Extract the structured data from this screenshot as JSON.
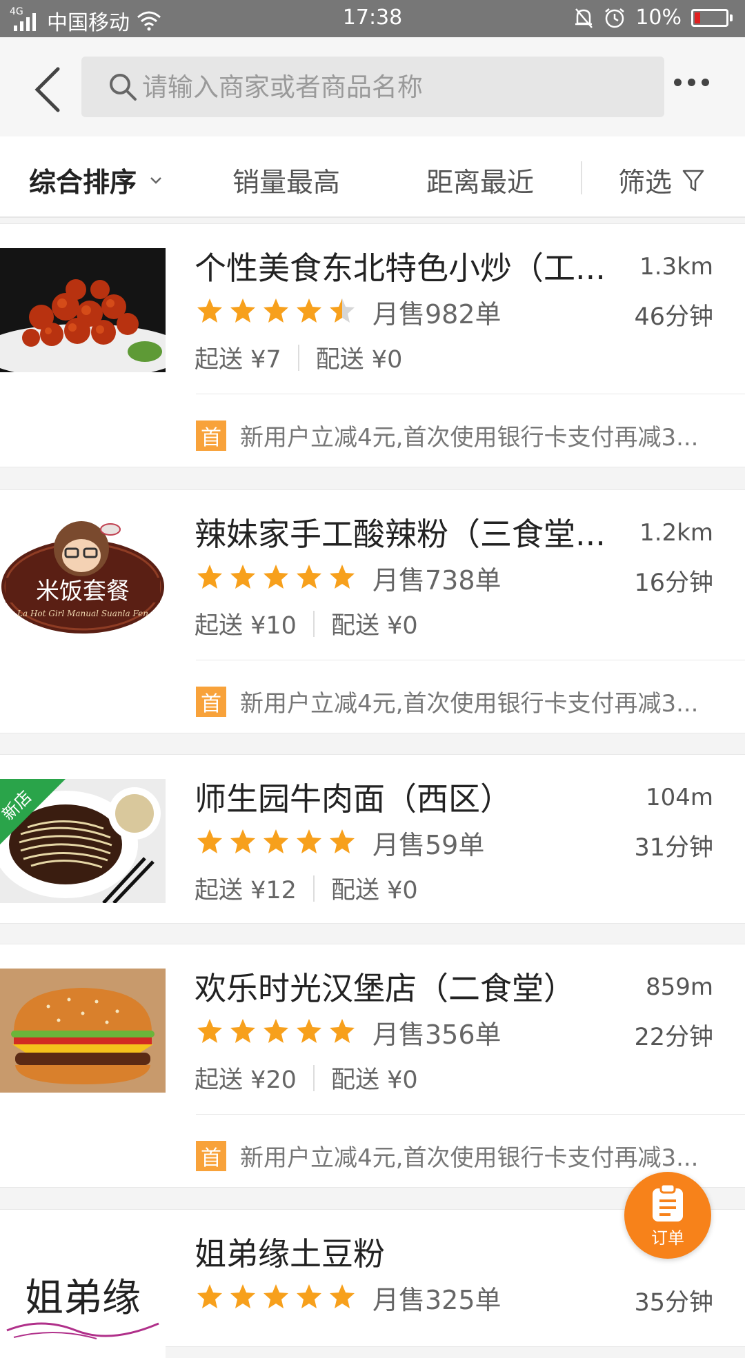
{
  "status_bar": {
    "network": "4G",
    "carrier": "中国移动",
    "time": "17:38",
    "battery": "10%",
    "icons": [
      "signal-icon",
      "wifi-icon",
      "bell-muted-icon",
      "alarm-icon",
      "battery-icon"
    ]
  },
  "search": {
    "placeholder": "请输入商家或者商品名称",
    "value": ""
  },
  "sort_tabs": [
    {
      "label": "综合排序",
      "active": true
    },
    {
      "label": "销量最高",
      "active": false
    },
    {
      "label": "距离最近",
      "active": false
    },
    {
      "label": "筛选",
      "active": false
    }
  ],
  "shops": [
    {
      "name": "个性美食东北特色小炒（工...",
      "distance": "1.3km",
      "rating": 4.5,
      "monthly_sales": "月售982单",
      "delivery_time": "46分钟",
      "min_order": "起送 ¥7",
      "delivery_fee": "配送 ¥0",
      "promo_badge": "首",
      "promo_text": "新用户立减4元,首次使用银行卡支付再减3...",
      "image": "fried-pork-dish",
      "new_store": false
    },
    {
      "name": "辣妹家手工酸辣粉（三食堂...",
      "distance": "1.2km",
      "rating": 5,
      "monthly_sales": "月售738单",
      "delivery_time": "16分钟",
      "min_order": "起送 ¥10",
      "delivery_fee": "配送 ¥0",
      "promo_badge": "首",
      "promo_text": "新用户立减4元,首次使用银行卡支付再减3...",
      "image": "spicy-girl-logo",
      "logo_text": "米饭套餐",
      "new_store": false
    },
    {
      "name": "师生园牛肉面（西区）",
      "distance": "104m",
      "rating": 5,
      "monthly_sales": "月售59单",
      "delivery_time": "31分钟",
      "min_order": "起送 ¥12",
      "delivery_fee": "配送 ¥0",
      "promo_badge": "",
      "promo_text": "",
      "image": "beef-noodle-bowl",
      "new_store": true,
      "new_store_label": "新店"
    },
    {
      "name": "欢乐时光汉堡店（二食堂）",
      "distance": "859m",
      "rating": 5,
      "monthly_sales": "月售356单",
      "delivery_time": "22分钟",
      "min_order": "起送 ¥20",
      "delivery_fee": "配送 ¥0",
      "promo_badge": "首",
      "promo_text": "新用户立减4元,首次使用银行卡支付再减3...",
      "image": "burger",
      "new_store": false
    },
    {
      "name": "姐弟缘土豆粉",
      "distance": "",
      "rating": 5,
      "monthly_sales": "月售325单",
      "delivery_time": "35分钟",
      "min_order": "",
      "delivery_fee": "",
      "promo_badge": "",
      "promo_text": "",
      "image": "jiediyuan-logo",
      "logo_text": "姐弟缘",
      "new_store": false
    }
  ],
  "order_fab": {
    "label": "订单"
  },
  "colors": {
    "accent": "#f7821a",
    "star": "#f7a01c",
    "promo_badge": "#f8a23a",
    "status_bar": "#777777"
  }
}
